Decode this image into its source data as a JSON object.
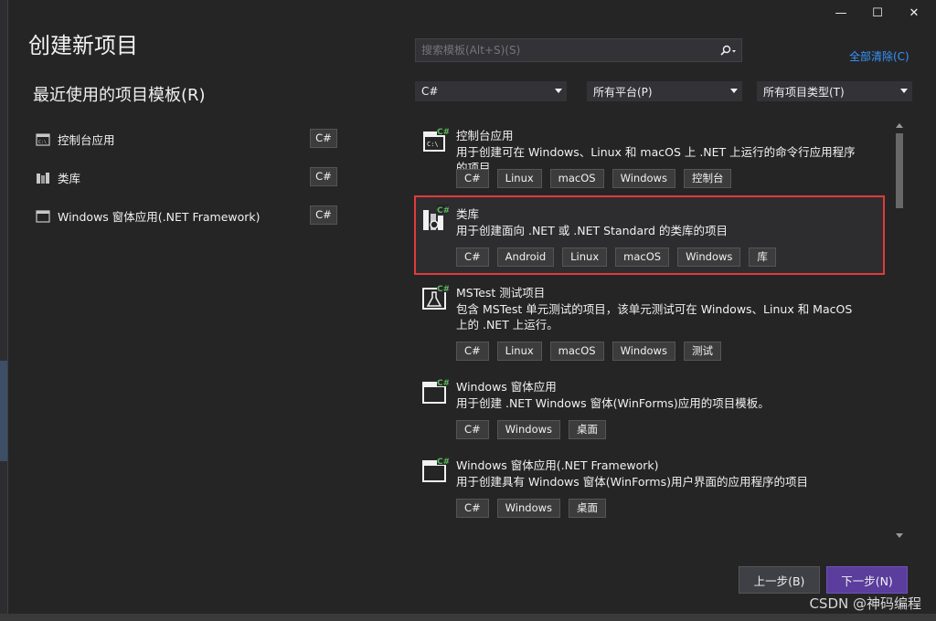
{
  "window": {
    "title": "创建新项目",
    "controls": {
      "minimize": "—",
      "maximize": "☐",
      "close": "✕"
    }
  },
  "recent": {
    "title": "最近使用的项目模板(R)",
    "items": [
      {
        "label": "控制台应用",
        "lang": "C#",
        "icon": "console-app-icon"
      },
      {
        "label": "类库",
        "lang": "C#",
        "icon": "class-library-icon"
      },
      {
        "label": "Windows 窗体应用(.NET Framework)",
        "lang": "C#",
        "icon": "winforms-icon"
      }
    ]
  },
  "search": {
    "placeholder": "搜索模板(Alt+S)(S)",
    "clear_all": "全部清除(C)"
  },
  "filters": {
    "language": "C#",
    "platform": "所有平台(P)",
    "project_type": "所有项目类型(T)"
  },
  "templates": [
    {
      "name": "控制台应用",
      "description": "用于创建可在 Windows、Linux 和 macOS 上 .NET 上运行的命令行应用程序的项目",
      "tags": [
        "C#",
        "Linux",
        "macOS",
        "Windows",
        "控制台"
      ],
      "selected": false,
      "icon": "console-app-icon"
    },
    {
      "name": "类库",
      "description": "用于创建面向 .NET 或 .NET Standard 的类库的项目",
      "tags": [
        "C#",
        "Android",
        "Linux",
        "macOS",
        "Windows",
        "库"
      ],
      "selected": true,
      "icon": "class-library-icon"
    },
    {
      "name": "MSTest 测试项目",
      "description": "包含 MSTest 单元测试的项目，该单元测试可在 Windows、Linux 和 MacOS 上的 .NET 上运行。",
      "tags": [
        "C#",
        "Linux",
        "macOS",
        "Windows",
        "测试"
      ],
      "selected": false,
      "icon": "test-project-icon"
    },
    {
      "name": "Windows 窗体应用",
      "description": "用于创建 .NET Windows 窗体(WinForms)应用的项目模板。",
      "tags": [
        "C#",
        "Windows",
        "桌面"
      ],
      "selected": false,
      "icon": "winforms-icon"
    },
    {
      "name": "Windows 窗体应用(.NET Framework)",
      "description": "用于创建具有 Windows 窗体(WinForms)用户界面的应用程序的项目",
      "tags": [
        "C#",
        "Windows",
        "桌面"
      ],
      "selected": false,
      "icon": "winforms-icon"
    }
  ],
  "footer": {
    "back": "上一步(B)",
    "next": "下一步(N)"
  },
  "watermark": "CSDN @神码编程",
  "colors": {
    "background": "#252526",
    "accent": "#5a3d9c",
    "selection_border": "#e23a3a",
    "link": "#3794ff"
  }
}
